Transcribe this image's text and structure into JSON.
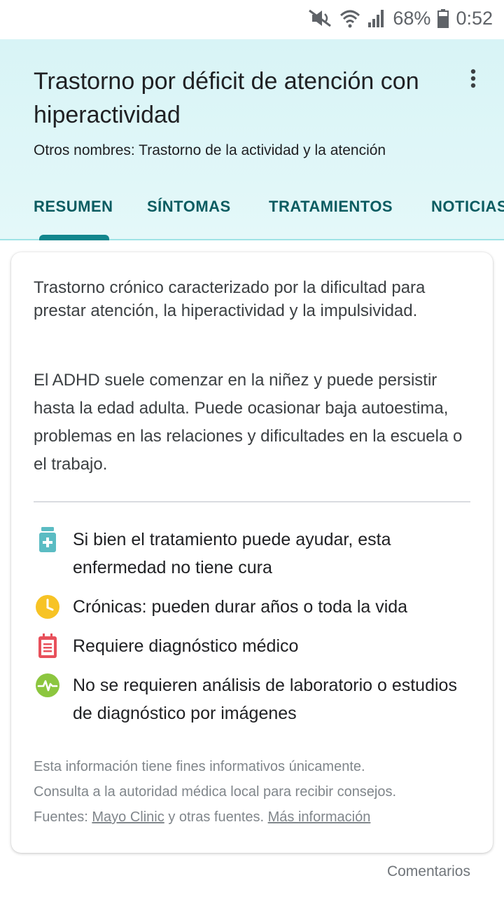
{
  "status_bar": {
    "battery_percent": "68%",
    "time": "0:52",
    "icons": [
      "mute-icon",
      "wifi-icon",
      "signal-icon",
      "battery-icon"
    ]
  },
  "header": {
    "title": "Trastorno por déficit de atención con hiperactividad",
    "other_names": "Otros nombres: Trastorno de la actividad y la atención",
    "tabs": [
      {
        "label": "RESUMEN",
        "selected": true
      },
      {
        "label": "SÍNTOMAS",
        "selected": false
      },
      {
        "label": "TRATAMIENTOS",
        "selected": false
      },
      {
        "label": "NOTICIAS",
        "selected": false
      }
    ]
  },
  "card": {
    "summary": "Trastorno crónico caracterizado por la dificultad para prestar atención, la hiperactividad y la impulsividad.",
    "details": "El ADHD suele comenzar en la niñez y puede persistir hasta la edad adulta. Puede ocasionar baja autoestima, problemas en las relaciones y dificultades en la escuela o el trabajo.",
    "facts": [
      {
        "icon": "medicine-bottle-icon",
        "text": "Si bien el tratamiento puede ayudar, esta enfermedad no tiene cura"
      },
      {
        "icon": "clock-icon",
        "text": "Crónicas: pueden durar años o toda la vida"
      },
      {
        "icon": "clipboard-icon",
        "text": "Requiere diagnóstico médico"
      },
      {
        "icon": "pulse-icon",
        "text": "No se requieren análisis de laboratorio o estudios de diagnóstico por imágenes"
      }
    ],
    "disclaimer": {
      "line1": "Esta información tiene fines informativos únicamente.",
      "line2": "Consulta a la autoridad médica local para recibir consejos.",
      "sources_prefix": "Fuentes:",
      "source_link": "Mayo Clinic",
      "sources_suffix": "y otras fuentes.",
      "more_link": "Más información"
    }
  },
  "feedback_label": "Comentarios",
  "colors": {
    "header_bg": "#d8f4f6",
    "tab_text": "#0b5c61",
    "tab_indicator": "#12868d",
    "medicine_icon": "#5bbcc3",
    "clock_icon": "#f7c325",
    "clipboard_icon": "#e8505b",
    "pulse_icon": "#8cc63f"
  }
}
